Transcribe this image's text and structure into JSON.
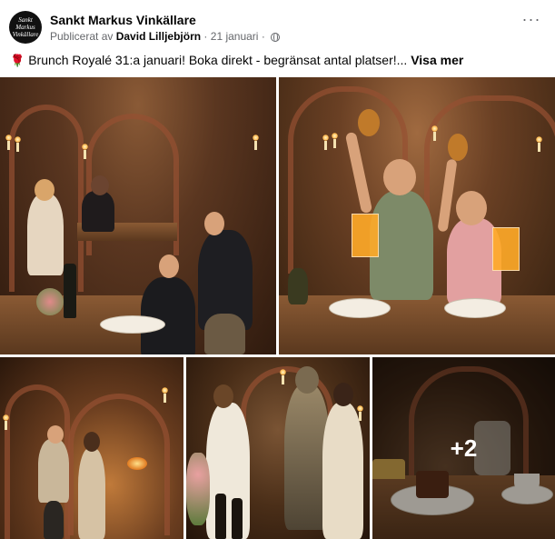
{
  "header": {
    "avatar_text": [
      "Sankt",
      "Markus",
      "Vinkällare"
    ],
    "page_name": "Sankt Markus Vinkällare",
    "published_by_prefix": "Publicerat av",
    "author": "David Lilljebjörn",
    "separator": "·",
    "date": "21 januari",
    "more_label": "···"
  },
  "post": {
    "emoji_icon": "rose-icon",
    "text": "Brunch Royalé 31:a januari! Boka direkt - begränsat antal platser!...",
    "see_more": "Visa mer"
  },
  "gallery": {
    "extra_count": "+2"
  }
}
